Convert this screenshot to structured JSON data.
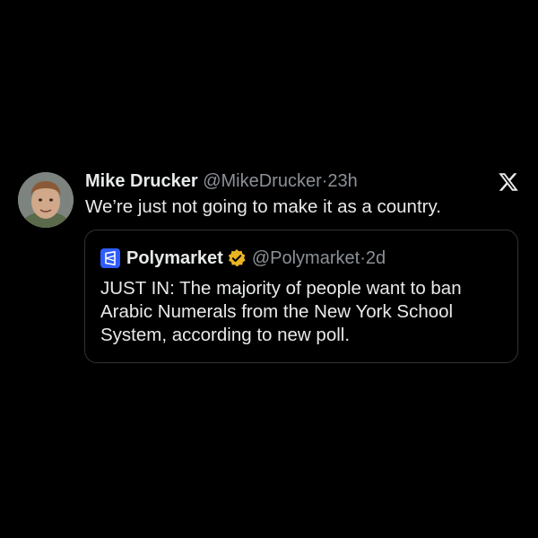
{
  "tweet": {
    "display_name": "Mike Drucker",
    "handle": "@MikeDrucker",
    "separator": "·",
    "time": "23h",
    "text": "We’re just not going to make it as a country."
  },
  "quoted_tweet": {
    "display_name": "Polymarket",
    "handle": "@Polymarket",
    "separator": "·",
    "time": "2d",
    "text": "JUST IN: The majority of people want to ban Arabic Numerals from the New York School System, according to new poll."
  },
  "icons": {
    "platform_logo": "x-logo-icon",
    "avatar": "avatar",
    "quoted_logo": "polymarket-logo-icon",
    "verified": "verified-badge-icon"
  },
  "colors": {
    "background": "#000000",
    "primary_text": "#e7e9ea",
    "secondary_text": "#8b9197",
    "border": "#2f3336",
    "polymarket_blue": "#2e5cff",
    "verified_gold": "#e8b423"
  }
}
